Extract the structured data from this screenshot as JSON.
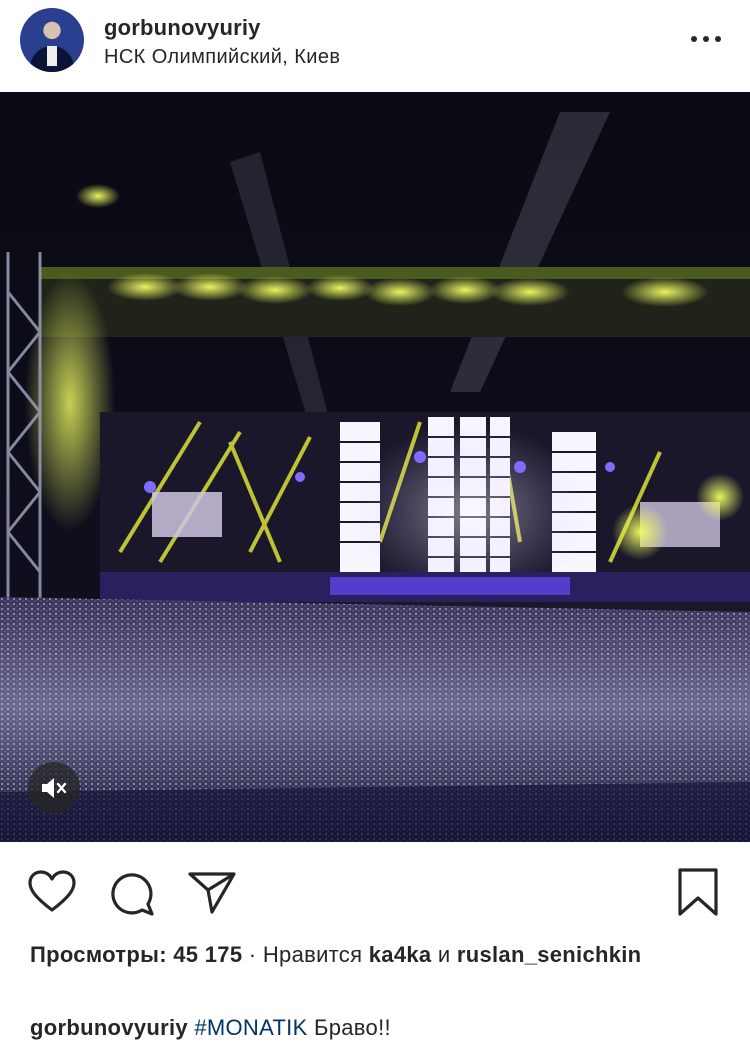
{
  "post": {
    "username": "gorbunovyuriy",
    "location": "НСК Олимпийский, Киев"
  },
  "icons": {
    "avatar": "avatar",
    "more": "more-horizontal-icon",
    "mute": "speaker-muted-icon",
    "like": "heart-outline-icon",
    "comment": "comment-bubble-icon",
    "share": "paper-plane-icon",
    "save": "bookmark-outline-icon"
  },
  "stats": {
    "views_label": "Просмотры:",
    "views_count": "45 175",
    "separator": "·",
    "liked_prefix": "Нравится",
    "liked_user1": "ka4ka",
    "liked_and": "и",
    "liked_user2": "ruslan_senichkin"
  },
  "caption": {
    "username": "gorbunovyuriy",
    "hashtag": "#MONATIK",
    "text": "Браво!!"
  },
  "colors": {
    "text": "#262626",
    "hashtag": "#003569",
    "stage_yellow": "#e8ef3a",
    "stage_purple": "#5a3fd6"
  }
}
